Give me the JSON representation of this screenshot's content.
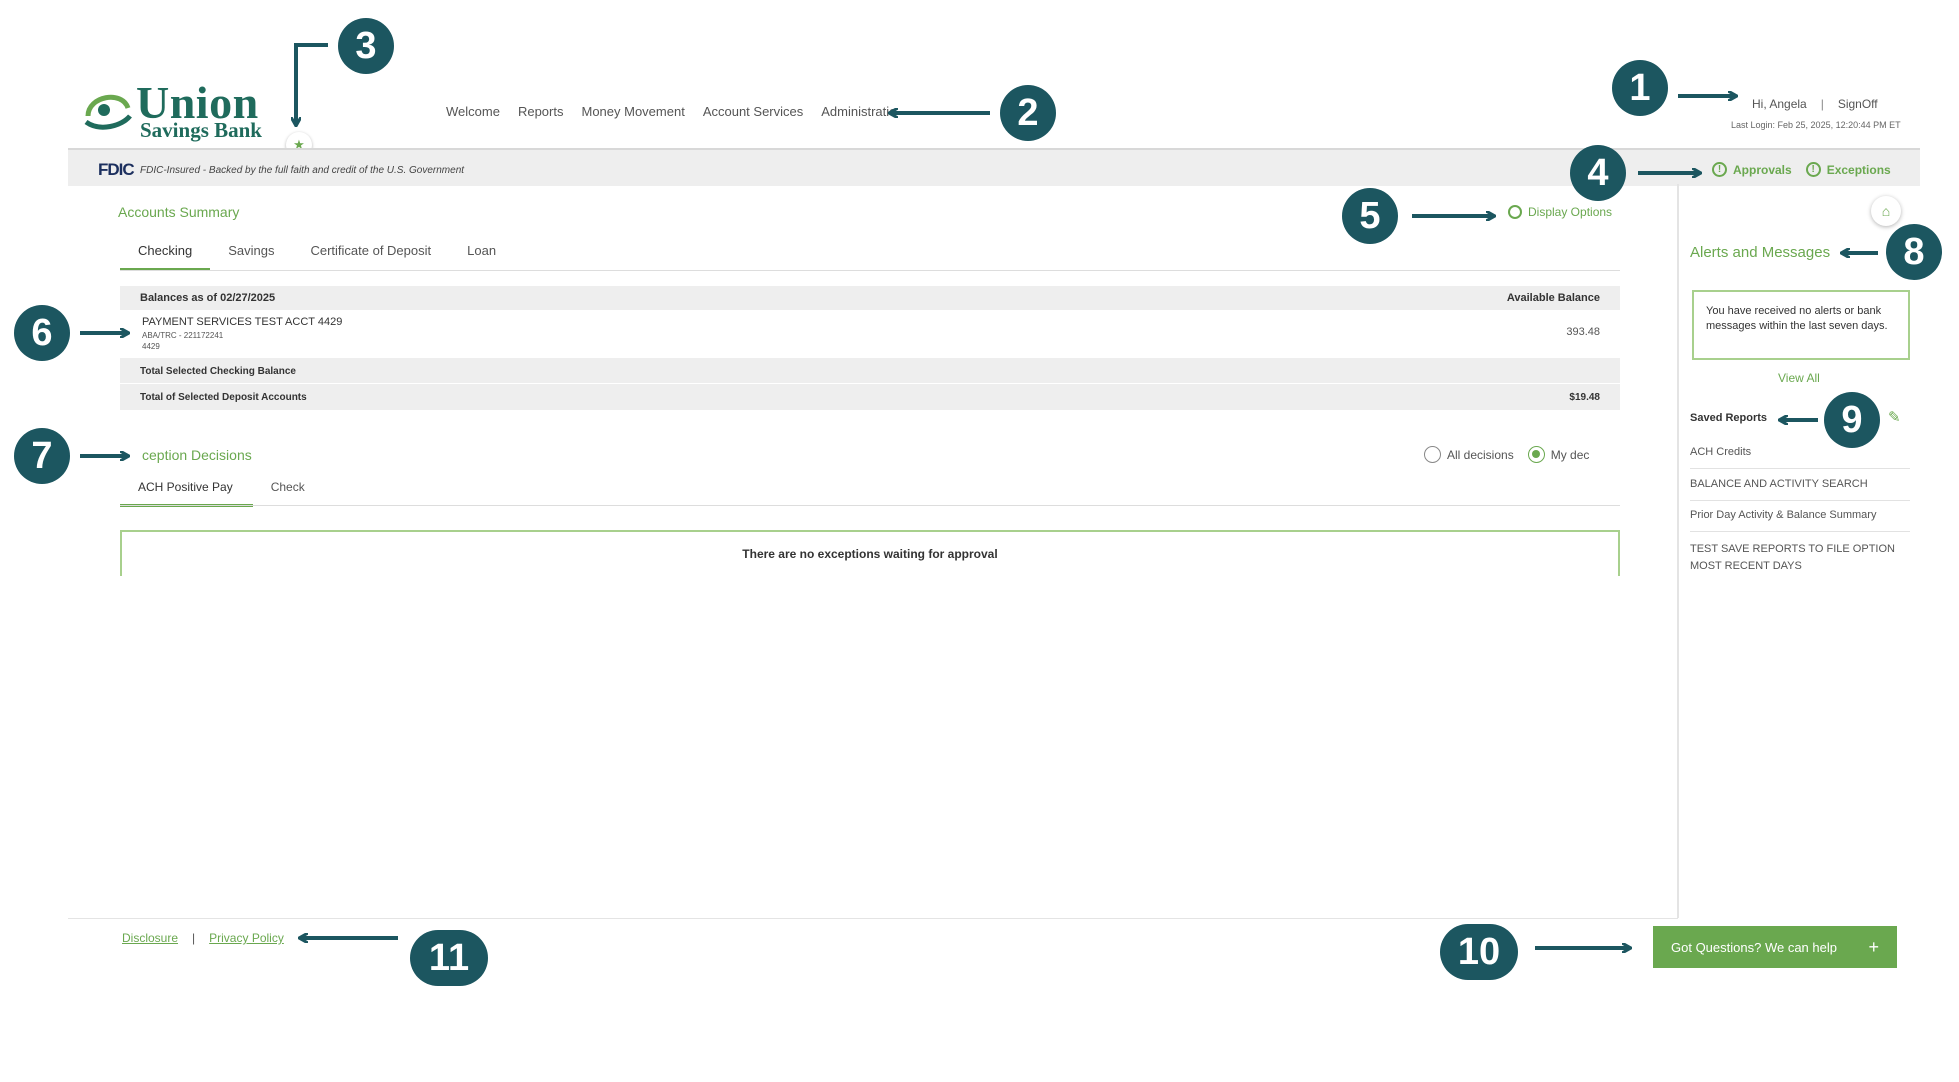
{
  "brand": {
    "name_line1": "Union",
    "name_line2": "Savings Bank"
  },
  "nav": {
    "items": [
      "Welcome",
      "Reports",
      "Money Movement",
      "Account Services",
      "Administratio"
    ]
  },
  "user": {
    "greeting": "Hi, Angela",
    "signoff": "SignOff",
    "last_login": "Last Login: Feb 25, 2025, 12:20:44 PM ET"
  },
  "fdic": {
    "logo": "FDIC",
    "text": "FDIC-Insured - Backed by the full faith and credit of the U.S. Government"
  },
  "header_actions": {
    "approvals": "Approvals",
    "exceptions": "Exceptions"
  },
  "accounts_summary": {
    "title": "Accounts Summary",
    "display_options": "Display Options",
    "tabs": [
      "Checking",
      "Savings",
      "Certificate of Deposit",
      "Loan"
    ],
    "balances_as_of": "Balances as of 02/27/2025",
    "available_header": "Available Balance",
    "account": {
      "name": "PAYMENT SERVICES TEST ACCT 4429",
      "routing": "ABA/TRC - 221172241",
      "number": "4429",
      "balance": "393.48"
    },
    "total_checking_label": "Total Selected Checking Balance",
    "total_deposit_label": "Total of Selected Deposit Accounts",
    "total_deposit_value": "$19.48"
  },
  "exceptions": {
    "title": "ception Decisions",
    "radio_all": "All decisions",
    "radio_mine": "My dec",
    "tabs": [
      "ACH Positive Pay",
      "Check"
    ],
    "empty_message": "There are no exceptions waiting for approval"
  },
  "sidebar": {
    "alerts_title": "Alerts and Messages",
    "alerts_message": "You have received no alerts or bank messages within the last seven days.",
    "view_all": "View All",
    "saved_reports_title": "Saved Reports",
    "reports": [
      "ACH Credits",
      "BALANCE AND ACTIVITY SEARCH",
      "Prior Day Activity & Balance Summary",
      "TEST SAVE REPORTS TO FILE OPTION MOST RECENT DAYS"
    ]
  },
  "footer": {
    "disclosure": "Disclosure",
    "privacy": "Privacy Policy"
  },
  "help": {
    "label": "Got Questions? We can help",
    "plus": "+"
  },
  "callouts": [
    "1",
    "2",
    "3",
    "4",
    "5",
    "6",
    "7",
    "8",
    "9",
    "10",
    "11"
  ],
  "colors": {
    "accent": "#6aa84f",
    "brand": "#1f6b5c",
    "callout": "#1c5660",
    "fdic_navy": "#1c2f5e"
  }
}
